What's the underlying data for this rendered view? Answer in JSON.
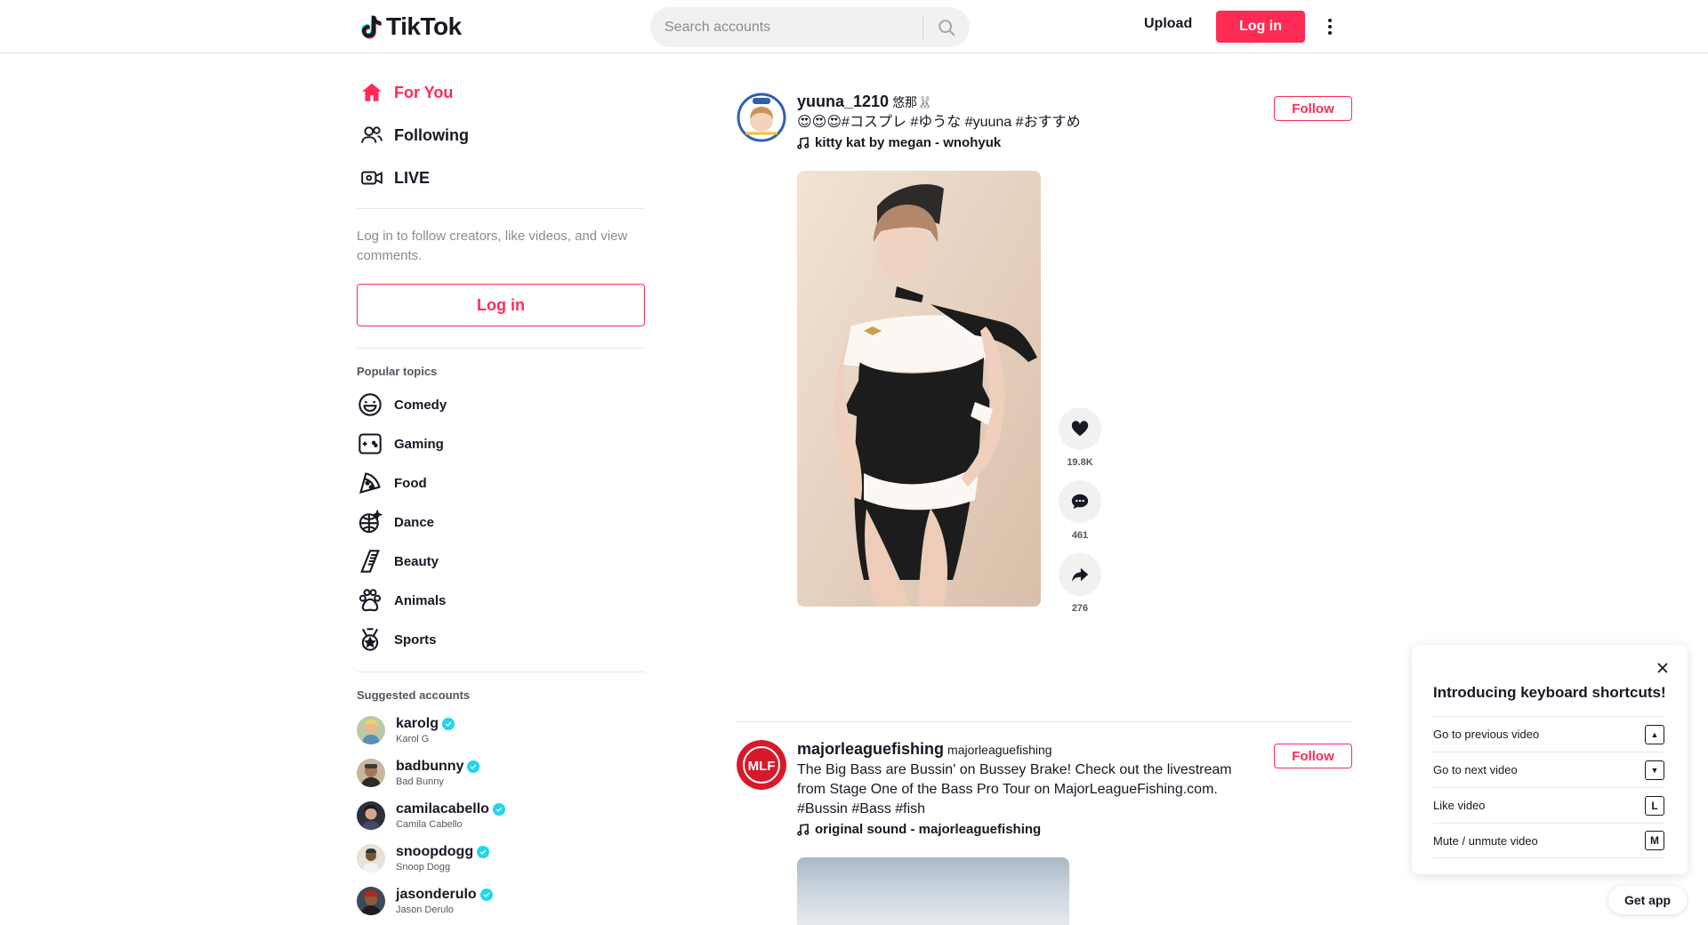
{
  "header": {
    "logo_text": "TikTok",
    "search_placeholder": "Search accounts",
    "upload_label": "Upload",
    "login_label": "Log in"
  },
  "sidebar": {
    "nav": [
      {
        "label": "For You",
        "icon": "home-icon",
        "active": true
      },
      {
        "label": "Following",
        "icon": "following-icon",
        "active": false
      },
      {
        "label": "LIVE",
        "icon": "live-icon",
        "active": false
      }
    ],
    "login_hint": "Log in to follow creators, like videos, and view comments.",
    "login_label": "Log in",
    "topics_title": "Popular topics",
    "topics": [
      {
        "label": "Comedy",
        "icon": "comedy-icon"
      },
      {
        "label": "Gaming",
        "icon": "gaming-icon"
      },
      {
        "label": "Food",
        "icon": "food-icon"
      },
      {
        "label": "Dance",
        "icon": "dance-icon"
      },
      {
        "label": "Beauty",
        "icon": "beauty-icon"
      },
      {
        "label": "Animals",
        "icon": "animals-icon"
      },
      {
        "label": "Sports",
        "icon": "sports-icon"
      }
    ],
    "suggested_title": "Suggested accounts",
    "accounts": [
      {
        "username": "karolg",
        "display_name": "Karol G",
        "verified": true
      },
      {
        "username": "badbunny",
        "display_name": "Bad Bunny",
        "verified": true
      },
      {
        "username": "camilacabello",
        "display_name": "Camila Cabello",
        "verified": true
      },
      {
        "username": "snoopdogg",
        "display_name": "Snoop Dogg",
        "verified": true
      },
      {
        "username": "jasonderulo",
        "display_name": "Jason Derulo",
        "verified": true
      }
    ]
  },
  "posts": [
    {
      "username": "yuuna_1210",
      "nickname": "悠那🐰",
      "caption": "😍😍😍#コスプレ #ゆうな #yuuna #おすすめ",
      "music": "kitty kat by megan - wnohyuk",
      "follow_label": "Follow",
      "likes": "19.8K",
      "comments": "461",
      "shares": "276"
    },
    {
      "username": "majorleaguefishing",
      "nickname": "majorleaguefishing",
      "caption": "The Big Bass are Bussin' on Bussey Brake! Check out the livestream from Stage One of the Bass Pro Tour on MajorLeagueFishing.com. #Bussin #Bass #fish",
      "music": "original sound - majorleaguefishing",
      "follow_label": "Follow",
      "avatar_text": "MLF"
    }
  ],
  "shortcuts": {
    "title": "Introducing keyboard shortcuts!",
    "items": [
      {
        "label": "Go to previous video",
        "key": "▲"
      },
      {
        "label": "Go to next video",
        "key": "▼"
      },
      {
        "label": "Like video",
        "key": "L"
      },
      {
        "label": "Mute / unmute video",
        "key": "M"
      }
    ]
  },
  "get_app_label": "Get app",
  "colors": {
    "brand": "#fe2c55",
    "verified": "#20d5ec",
    "text": "#161823",
    "muted": "#8a8b91"
  }
}
